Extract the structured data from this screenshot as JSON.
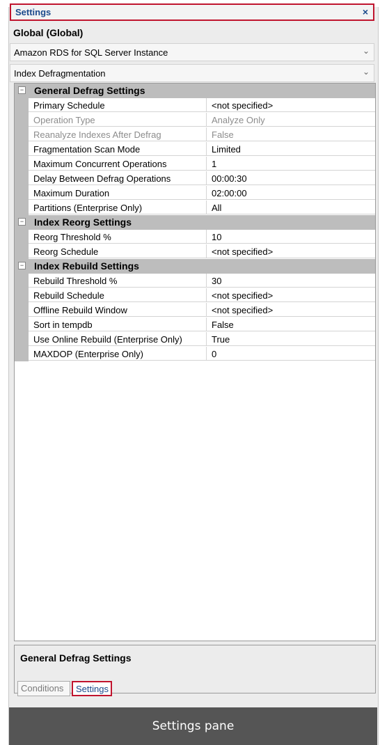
{
  "window": {
    "title": "Settings",
    "close_glyph": "×"
  },
  "scope_label": "Global (Global)",
  "instance_dropdown": {
    "value": "Amazon RDS for SQL Server Instance"
  },
  "feature_dropdown": {
    "value": "Index Defragmentation"
  },
  "categories": [
    {
      "name": "General Defrag Settings",
      "props": [
        {
          "name": "Primary Schedule",
          "value": "<not specified>",
          "disabled": false
        },
        {
          "name": "Operation Type",
          "value": "Analyze Only",
          "disabled": true
        },
        {
          "name": "Reanalyze Indexes After Defrag",
          "value": "False",
          "disabled": true
        },
        {
          "name": "Fragmentation Scan Mode",
          "value": "Limited",
          "disabled": false
        },
        {
          "name": "Maximum Concurrent Operations",
          "value": "1",
          "disabled": false
        },
        {
          "name": "Delay Between Defrag Operations",
          "value": "00:00:30",
          "disabled": false
        },
        {
          "name": "Maximum Duration",
          "value": "02:00:00",
          "disabled": false
        },
        {
          "name": "Partitions (Enterprise Only)",
          "value": "All",
          "disabled": false
        }
      ]
    },
    {
      "name": "Index Reorg Settings",
      "props": [
        {
          "name": "Reorg Threshold %",
          "value": "10",
          "disabled": false
        },
        {
          "name": "Reorg Schedule",
          "value": "<not specified>",
          "disabled": false
        }
      ]
    },
    {
      "name": "Index Rebuild Settings",
      "props": [
        {
          "name": "Rebuild Threshold %",
          "value": "30",
          "disabled": false
        },
        {
          "name": "Rebuild Schedule",
          "value": "<not specified>",
          "disabled": false
        },
        {
          "name": "Offline Rebuild Window",
          "value": "<not specified>",
          "disabled": false
        },
        {
          "name": "Sort in tempdb",
          "value": "False",
          "disabled": false
        },
        {
          "name": "Use Online Rebuild (Enterprise Only)",
          "value": "True",
          "disabled": false
        },
        {
          "name": "MAXDOP (Enterprise Only)",
          "value": "0",
          "disabled": false
        }
      ]
    }
  ],
  "description": {
    "title": "General Defrag Settings"
  },
  "tabs": {
    "conditions": "Conditions",
    "settings": "Settings"
  },
  "caption": "Settings pane",
  "colors": {
    "accent": "#c0142e",
    "title_text": "#1b4a8c",
    "category_bg": "#bdbdbd",
    "disabled_text": "#8c8c8c"
  },
  "icons": {
    "expand_toggle": "minus-box-icon",
    "dropdown": "chevron-down-icon",
    "close": "close-icon"
  }
}
